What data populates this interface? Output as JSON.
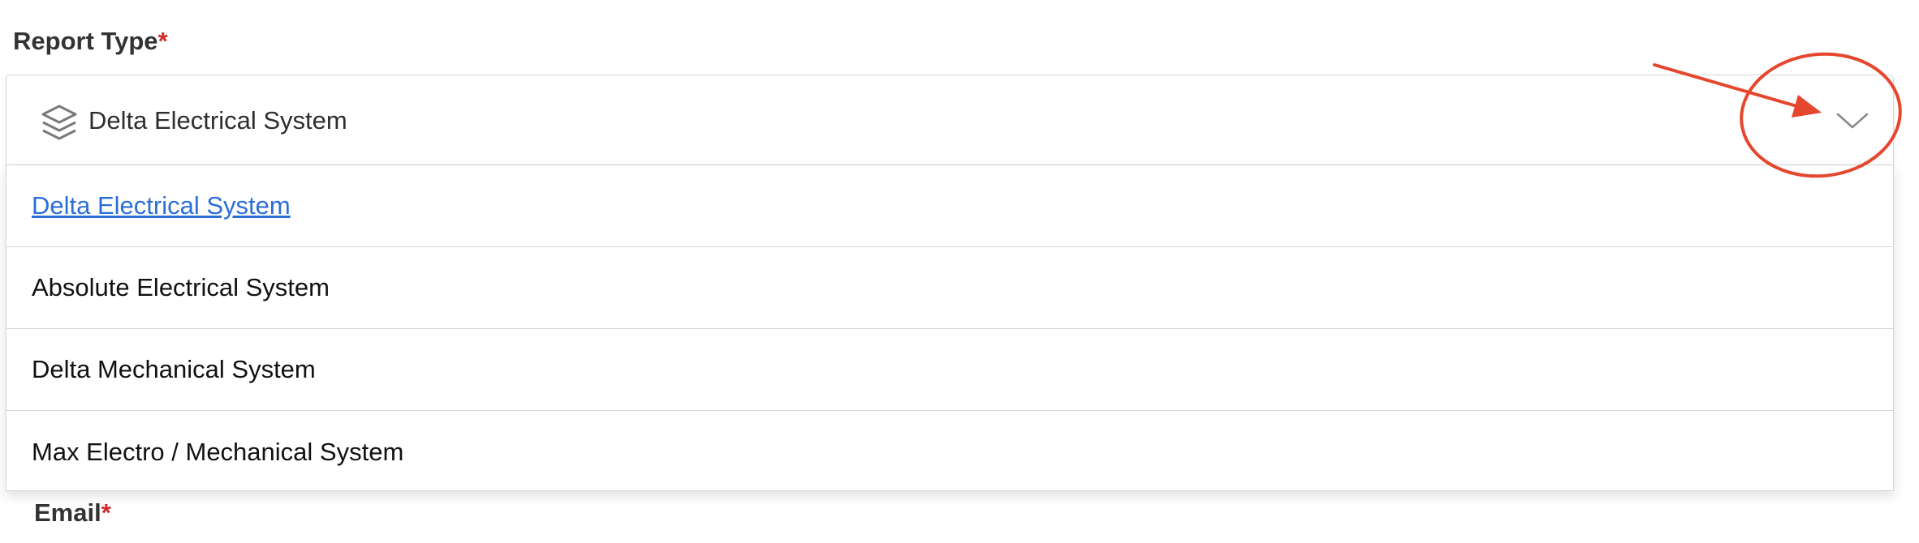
{
  "form": {
    "report_type_label": "Report Type",
    "required_marker": "*",
    "email_label": "Email"
  },
  "select": {
    "selected_value": "Delta Electrical System",
    "icon": "layers-icon",
    "toggle_icon": "chevron-down-icon"
  },
  "dropdown": {
    "options": [
      {
        "label": "Delta Electrical System",
        "selected": true
      },
      {
        "label": "Absolute Electrical System",
        "selected": false
      },
      {
        "label": "Delta Mechanical System",
        "selected": false
      },
      {
        "label": "Max Electro / Mechanical System",
        "selected": false
      }
    ]
  },
  "colors": {
    "required": "#d42a2a",
    "selected_option": "#2a6ed8",
    "annotation": "#e5472e"
  }
}
